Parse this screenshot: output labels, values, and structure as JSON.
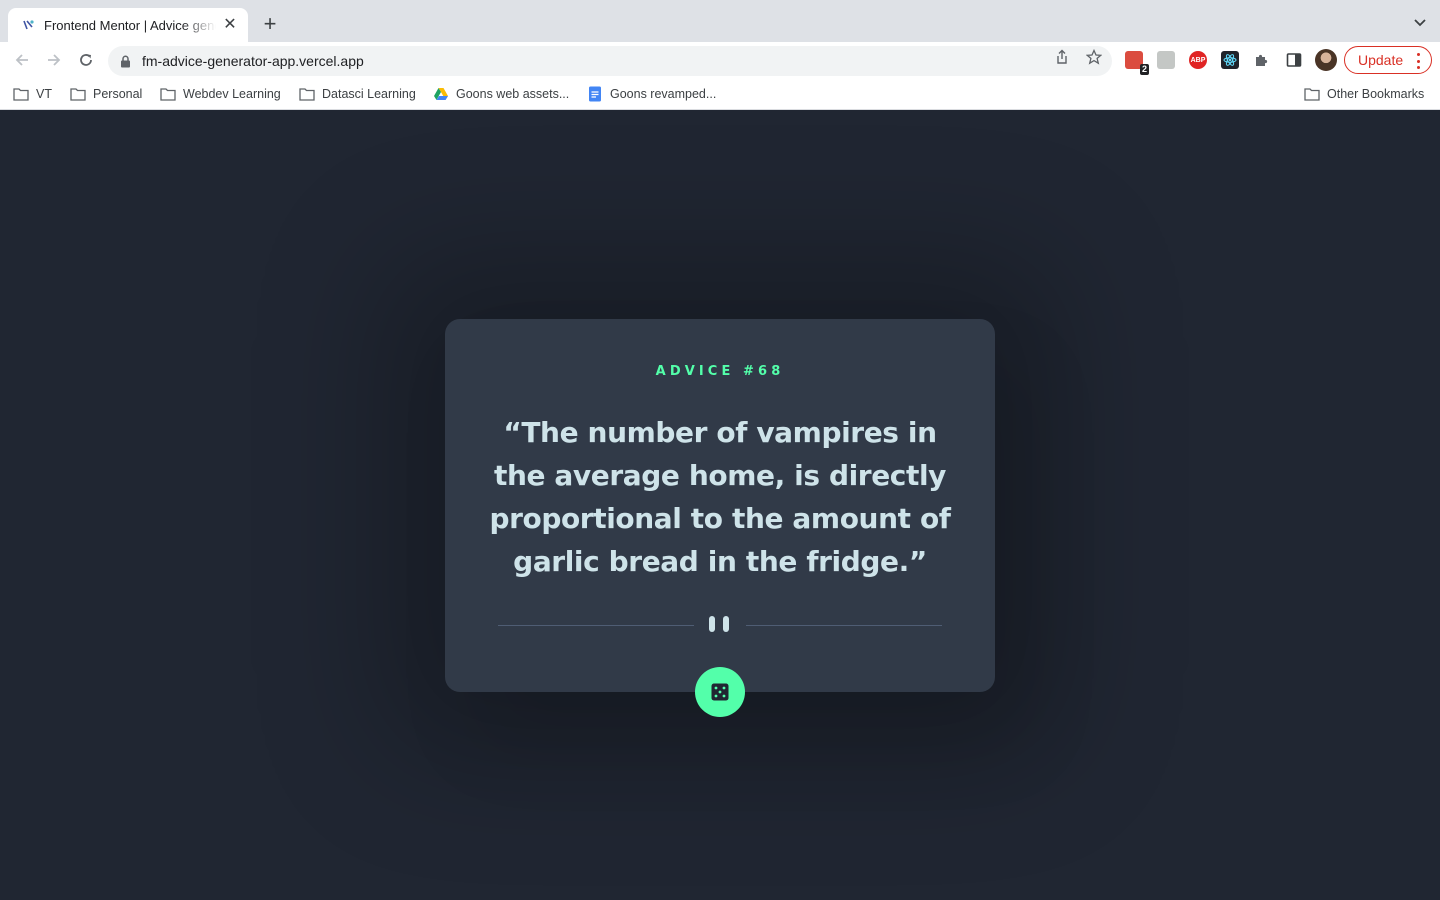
{
  "browser": {
    "tab_title": "Frontend Mentor | Advice generator app",
    "url": "fm-advice-generator-app.vercel.app",
    "update_label": "Update",
    "extension_badge": "2",
    "abp_label": "ABP",
    "bookmarks": [
      {
        "label": "VT",
        "icon": "folder-icon"
      },
      {
        "label": "Personal",
        "icon": "folder-icon"
      },
      {
        "label": "Webdev Learning",
        "icon": "folder-icon"
      },
      {
        "label": "Datasci Learning",
        "icon": "folder-icon"
      },
      {
        "label": "Goons web assets...",
        "icon": "google-drive-icon"
      },
      {
        "label": "Goons revamped...",
        "icon": "google-docs-icon"
      }
    ],
    "other_bookmarks": "Other Bookmarks"
  },
  "advice": {
    "heading": "ADVICE #68",
    "quote": "“The number of vampires in the average home, is directly proportional to the amount of garlic bread in the fridge.”"
  },
  "colors": {
    "page_bg": "#202632",
    "card_bg": "#313a48",
    "accent": "#53ffaa",
    "quote_text": "#cee3e9",
    "divider": "#4f5d74"
  }
}
